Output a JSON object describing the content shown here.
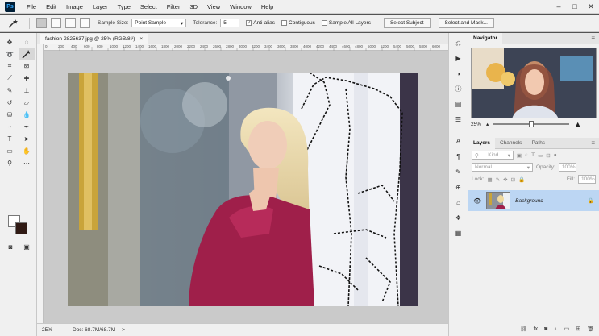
{
  "app": {
    "logo": "Ps",
    "menu": [
      "File",
      "Edit",
      "Image",
      "Layer",
      "Type",
      "Select",
      "Filter",
      "3D",
      "View",
      "Window",
      "Help"
    ],
    "window_controls": [
      "–",
      "□",
      "✕"
    ]
  },
  "options": {
    "sample_size_label": "Sample Size:",
    "sample_size_value": "Point Sample",
    "tolerance_label": "Tolerance:",
    "tolerance_value": "5",
    "anti_alias": "Anti-alias",
    "contiguous": "Contiguous",
    "sample_all_layers": "Sample All Layers",
    "select_subject": "Select Subject",
    "select_and_mask": "Select and Mask..."
  },
  "document": {
    "tab_title": "fashion-2825637.jpg @ 25% (RGB/8#)",
    "tab_close": "×",
    "ruler_ticks": [
      "0",
      "200",
      "400",
      "600",
      "800",
      "1000",
      "1200",
      "1400",
      "1600",
      "1800",
      "2000",
      "2200",
      "2400",
      "2600",
      "2800",
      "3000",
      "3200",
      "3400",
      "3600",
      "3800",
      "4000",
      "4200",
      "4400",
      "4600",
      "4800",
      "5000",
      "5200",
      "5400",
      "5600",
      "5800",
      "6000"
    ]
  },
  "status": {
    "zoom": "25%",
    "doc_size": "Doc: 68.7M/68.7M",
    "arrow": ">"
  },
  "navigator": {
    "title": "Navigator",
    "zoom": "25%"
  },
  "layers_panel": {
    "tabs": [
      "Layers",
      "Channels",
      "Paths"
    ],
    "kind_placeholder": "Kind",
    "blend_mode": "Normal",
    "opacity_label": "Opacity:",
    "opacity_value": "100%",
    "lock_label": "Lock:",
    "fill_label": "Fill:",
    "fill_value": "100%",
    "layer_name": "Background"
  },
  "colors": {
    "accent": "#bcd6f3",
    "dress": "#9f1f4a",
    "background_swatch": "#301a14"
  }
}
